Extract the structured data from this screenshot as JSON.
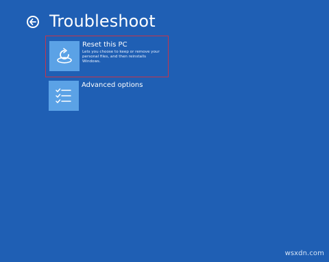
{
  "header": {
    "title": "Troubleshoot",
    "back_icon": "back-arrow-icon"
  },
  "options": [
    {
      "title": "Reset this PC",
      "description": "Lets you choose to keep or remove your personal files, and then reinstalls Windows.",
      "icon": "reset-pc-icon",
      "selected": true
    },
    {
      "title": "Advanced options",
      "icon": "checklist-icon",
      "selected": false
    }
  ],
  "watermark": "wsxdn.com",
  "colors": {
    "background": "#1f5fb4",
    "tile": "#5ba2e6",
    "selection_border": "#c7344a",
    "text": "#ffffff"
  }
}
